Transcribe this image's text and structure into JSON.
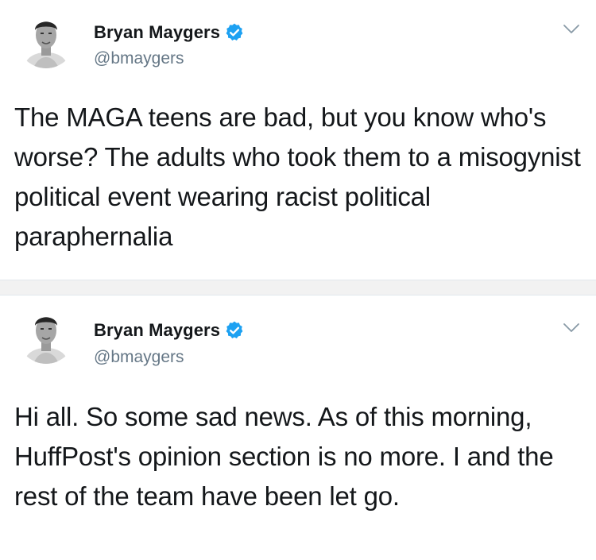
{
  "colors": {
    "text": "#14171a",
    "handle": "#657786",
    "verified": "#1da1f2",
    "separator": "#f2f2f2"
  },
  "tweets": [
    {
      "display_name": "Bryan Maygers",
      "handle": "@bmaygers",
      "verified_icon": "verified-badge-icon",
      "menu_icon": "chevron-down-icon",
      "text": "The MAGA teens are bad, but you know who's worse? The adults who took them to a misogynist political event wearing racist political paraphernalia"
    },
    {
      "display_name": "Bryan Maygers",
      "handle": "@bmaygers",
      "verified_icon": "verified-badge-icon",
      "menu_icon": "chevron-down-icon",
      "text": "Hi all. So some sad news. As of this morning, HuffPost's opinion section is no more. I and the rest of the team have been let go."
    }
  ]
}
